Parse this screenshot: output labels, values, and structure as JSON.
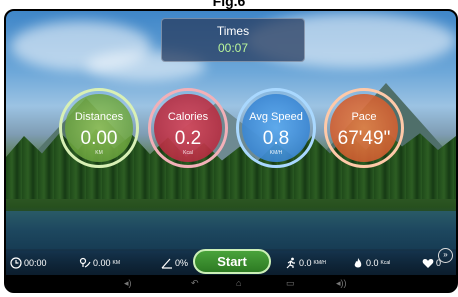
{
  "page_caption": "Fig.6",
  "times": {
    "label": "Times",
    "value": "00:07"
  },
  "gauges": [
    {
      "label": "Distances",
      "value": "0.00",
      "unit": "KM"
    },
    {
      "label": "Calories",
      "value": "0.2",
      "unit": "Kcal"
    },
    {
      "label": "Avg Speed",
      "value": "0.8",
      "unit": "KM/H"
    },
    {
      "label": "Pace",
      "value": "67'49\"",
      "unit": ""
    }
  ],
  "bottom_bar": {
    "time": "00:00",
    "distance": "0.00",
    "distance_unit": "KM",
    "incline": "0%",
    "start_label": "Start",
    "speed": "0.0",
    "speed_unit": "KM/H",
    "calories": "0.0",
    "calories_unit": "Kcal",
    "heart_rate": "0"
  },
  "colors": {
    "distance": "#7fb05a",
    "calories": "#c23a4a",
    "speed": "#3f8fd8",
    "pace": "#d46b3c",
    "start_green": "#3f9132"
  },
  "icons": [
    "clock-icon",
    "distance-icon",
    "incline-icon",
    "runner-icon",
    "flame-icon",
    "heart-icon",
    "back-icon",
    "home-icon",
    "recent-apps-icon",
    "volume-icon"
  ]
}
